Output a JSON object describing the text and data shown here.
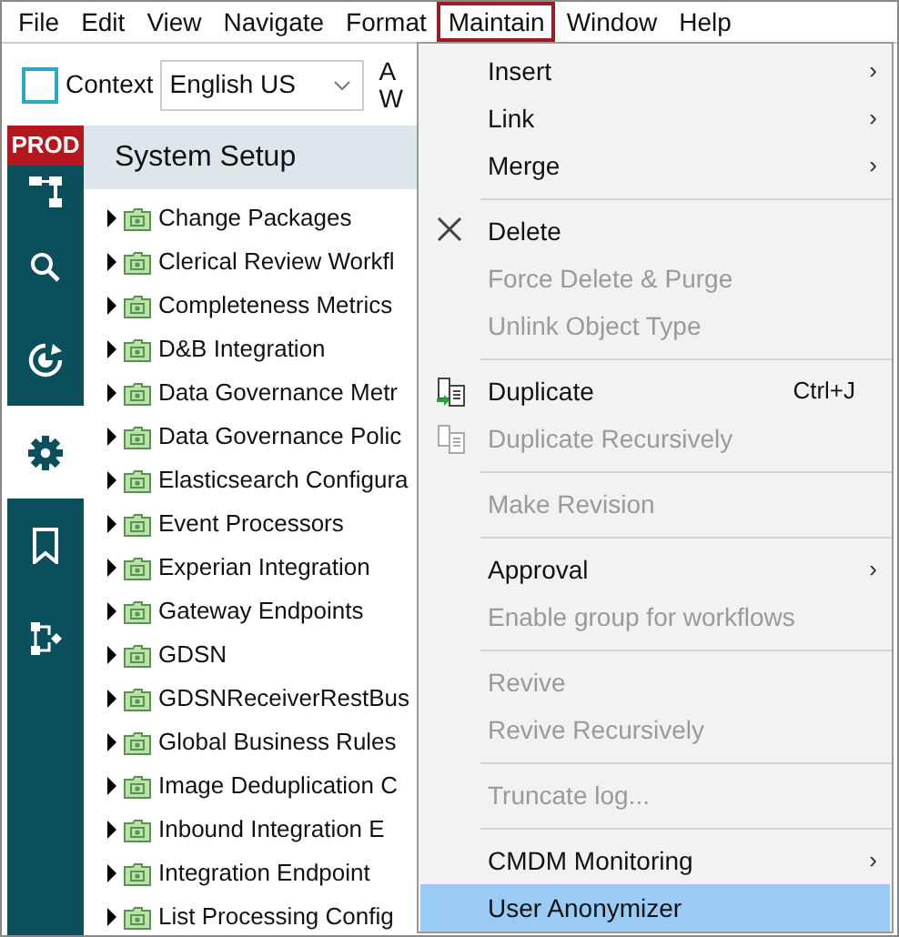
{
  "menubar": [
    {
      "label": "File",
      "selected": false
    },
    {
      "label": "Edit",
      "selected": false
    },
    {
      "label": "View",
      "selected": false
    },
    {
      "label": "Navigate",
      "selected": false
    },
    {
      "label": "Format",
      "selected": false
    },
    {
      "label": "Maintain",
      "selected": true
    },
    {
      "label": "Window",
      "selected": false
    },
    {
      "label": "Help",
      "selected": false
    }
  ],
  "toolbar": {
    "context_label": "Context",
    "context_value": "English US",
    "cut_texts": [
      "A",
      "W"
    ]
  },
  "sidebar": {
    "badge": "PROD",
    "items": [
      {
        "kind": "tree",
        "selected": false
      },
      {
        "kind": "search",
        "selected": false
      },
      {
        "kind": "history",
        "selected": false
      },
      {
        "kind": "settings",
        "selected": true
      },
      {
        "kind": "bookmark",
        "selected": false
      },
      {
        "kind": "workflow",
        "selected": false
      }
    ]
  },
  "panel": {
    "title": "System Setup",
    "items": [
      {
        "label": "Change Packages"
      },
      {
        "label": "Clerical Review Workfl"
      },
      {
        "label": "Completeness Metrics"
      },
      {
        "label": "D&B Integration"
      },
      {
        "label": "Data Governance Metr"
      },
      {
        "label": "Data Governance Polic"
      },
      {
        "label": "Elasticsearch Configura"
      },
      {
        "label": "Event Processors"
      },
      {
        "label": "Experian Integration"
      },
      {
        "label": "Gateway Endpoints"
      },
      {
        "label": "GDSN"
      },
      {
        "label": "GDSNReceiverRestBus"
      },
      {
        "label": "Global Business Rules"
      },
      {
        "label": "Image Deduplication C"
      },
      {
        "label": "Inbound Integration E"
      },
      {
        "label": "Integration Endpoint"
      },
      {
        "label": "List Processing Config"
      }
    ]
  },
  "menu": [
    {
      "kind": "item",
      "label": "Insert",
      "disabled": false,
      "arrow": "›",
      "selected": false
    },
    {
      "kind": "item",
      "label": "Link",
      "disabled": false,
      "arrow": "›",
      "selected": false
    },
    {
      "kind": "item",
      "label": "Merge",
      "disabled": false,
      "arrow": "›",
      "selected": false
    },
    {
      "kind": "separator"
    },
    {
      "kind": "delete",
      "label": "Delete",
      "disabled": false,
      "selected": false
    },
    {
      "kind": "item",
      "label": "Force Delete & Purge",
      "disabled": true,
      "selected": false
    },
    {
      "kind": "item",
      "label": "Unlink Object Type",
      "disabled": true,
      "selected": false
    },
    {
      "kind": "separator"
    },
    {
      "kind": "duplicate",
      "label": "Duplicate",
      "disabled": false,
      "selected": false,
      "shortcut": "Ctrl+J"
    },
    {
      "kind": "duplicate",
      "label": "Duplicate Recursively",
      "disabled": true,
      "selected": false
    },
    {
      "kind": "separator"
    },
    {
      "kind": "item",
      "label": "Make Revision",
      "disabled": true,
      "selected": false
    },
    {
      "kind": "separator"
    },
    {
      "kind": "item",
      "label": "Approval",
      "disabled": false,
      "arrow": "›",
      "selected": false
    },
    {
      "kind": "item",
      "label": "Enable group for workflows",
      "disabled": true,
      "selected": false
    },
    {
      "kind": "separator"
    },
    {
      "kind": "item",
      "label": "Revive",
      "disabled": true,
      "selected": false
    },
    {
      "kind": "item",
      "label": "Revive Recursively",
      "disabled": true,
      "selected": false
    },
    {
      "kind": "separator"
    },
    {
      "kind": "item",
      "label": "Truncate log...",
      "disabled": true,
      "selected": false
    },
    {
      "kind": "separator"
    },
    {
      "kind": "item",
      "label": "CMDM Monitoring",
      "disabled": false,
      "arrow": "›",
      "selected": false
    },
    {
      "kind": "item",
      "label": "User Anonymizer",
      "disabled": false,
      "selected": true
    }
  ]
}
